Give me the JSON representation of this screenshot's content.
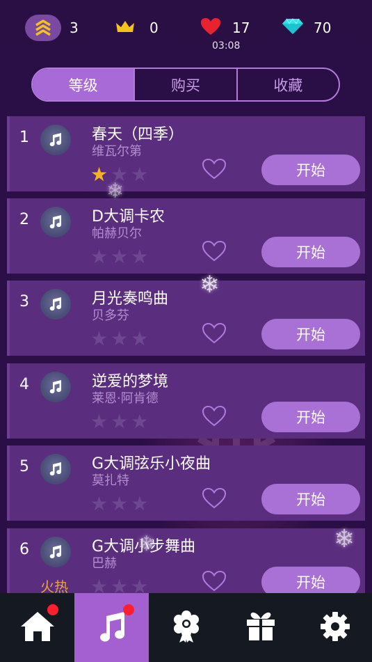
{
  "hud": {
    "rank": {
      "value": "3",
      "icon": "rank-chevrons-icon"
    },
    "crowns": {
      "value": "0",
      "icon": "crown-icon"
    },
    "lives": {
      "value": "17",
      "icon": "heart-icon",
      "timer": "03:08"
    },
    "diamonds": {
      "value": "70",
      "icon": "diamond-icon"
    }
  },
  "tabs": [
    {
      "label": "等级",
      "active": true
    },
    {
      "label": "购买",
      "active": false
    },
    {
      "label": "收藏",
      "active": false
    }
  ],
  "songs": [
    {
      "num": "1",
      "title": "春天（四季）",
      "composer": "维瓦尔第",
      "stars": 1,
      "button": "开始"
    },
    {
      "num": "2",
      "title": "D大调卡农",
      "composer": "帕赫贝尔",
      "stars": 0,
      "button": "开始"
    },
    {
      "num": "3",
      "title": "月光奏鸣曲",
      "composer": "贝多芬",
      "stars": 0,
      "button": "开始"
    },
    {
      "num": "4",
      "title": "逆爱的梦境",
      "composer": "莱恩·阿肯德",
      "stars": 0,
      "button": "开始"
    },
    {
      "num": "5",
      "title": "G大调弦乐小夜曲",
      "composer": "莫扎特",
      "stars": 0,
      "button": "开始"
    },
    {
      "num": "6",
      "title": "G大调小步舞曲",
      "composer": "巴赫",
      "stars": 0,
      "button": "开始",
      "badge": "火热"
    }
  ],
  "nav": [
    {
      "icon": "home-icon",
      "active": false,
      "notification": true
    },
    {
      "icon": "music-note-icon",
      "active": true,
      "notification": true
    },
    {
      "icon": "flower-badge-icon",
      "active": false,
      "notification": false
    },
    {
      "icon": "gift-icon",
      "active": false,
      "notification": false
    },
    {
      "icon": "settings-gear-icon",
      "active": false,
      "notification": false
    }
  ],
  "colors": {
    "background": "#2a0f45",
    "row": "#5a2d7e",
    "accent": "#a86ad6",
    "star_on": "#f5b321",
    "star_off": "#6d4890",
    "hot": "#e8a43a",
    "nav_bg": "#151922",
    "notification": "#ff1f2e"
  }
}
